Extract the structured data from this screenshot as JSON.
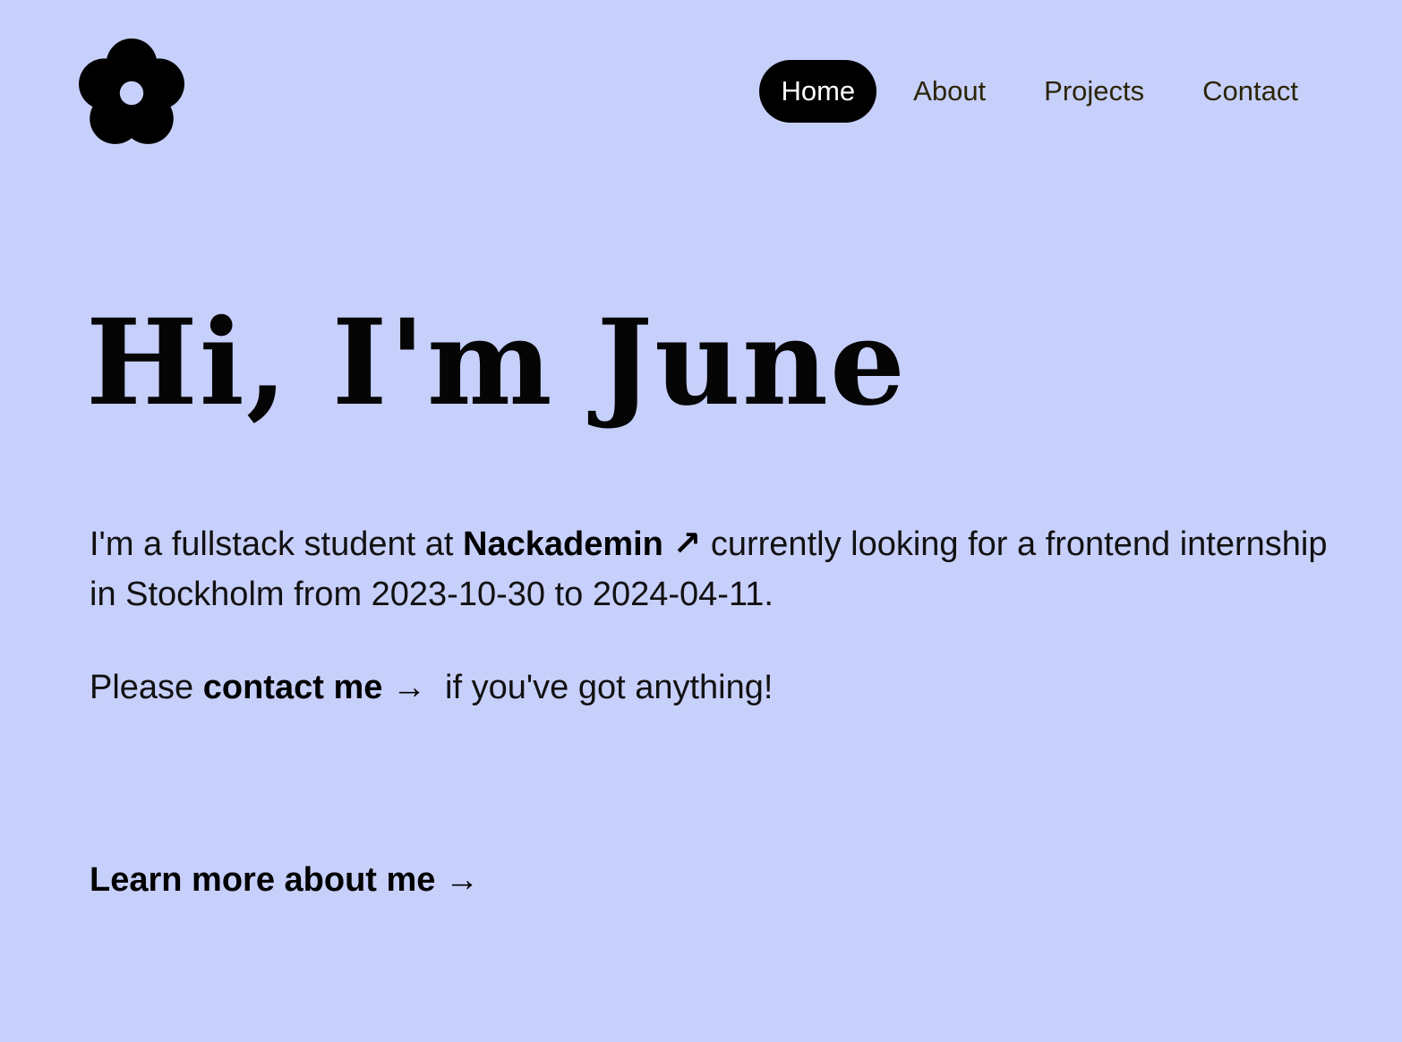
{
  "colors": {
    "background": "#c7cffb",
    "nav_active_bg": "#000000",
    "nav_active_text": "#ffffff",
    "nav_text": "#2b2406",
    "body_text": "#111111"
  },
  "header": {
    "logo_icon": "flower-icon",
    "nav": [
      {
        "label": "Home",
        "active": true
      },
      {
        "label": "About",
        "active": false
      },
      {
        "label": "Projects",
        "active": false
      },
      {
        "label": "Contact",
        "active": false
      }
    ]
  },
  "hero": {
    "title": "Hi, I'm June"
  },
  "intro": {
    "prefix": "I'm a fullstack student at ",
    "school_link": "Nackademin",
    "external_arrow": "↗",
    "suffix": " currently looking for a frontend internship in Stockholm from 2023-10-30 to 2024-04-11."
  },
  "contact_line": {
    "prefix": "Please ",
    "link": "contact me",
    "arrow": "→",
    "suffix": "  if you've got anything!"
  },
  "learn_more": {
    "label": "Learn more about me",
    "arrow": "→"
  }
}
